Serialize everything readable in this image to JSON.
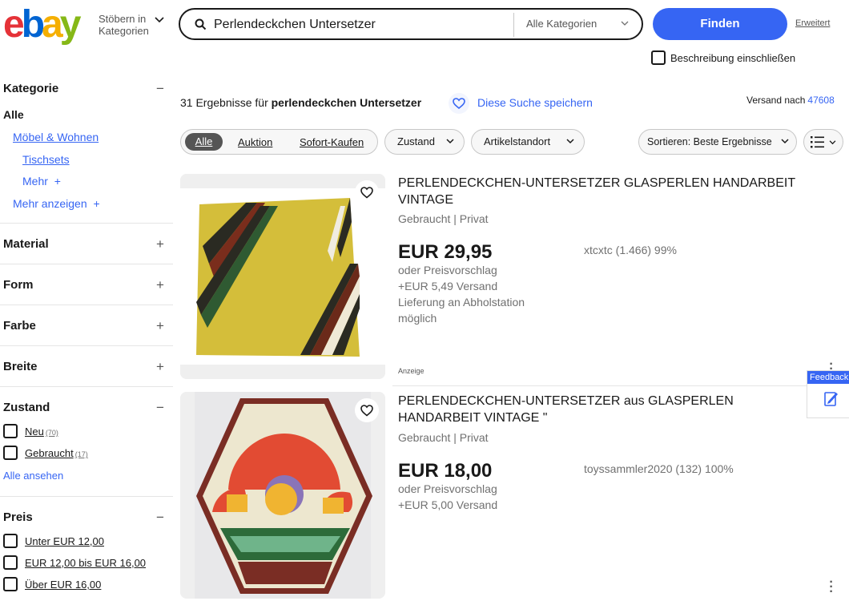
{
  "header": {
    "logo_text": "ebay",
    "browse_line1": "Stöbern in",
    "browse_line2": "Kategorien",
    "search_value": "Perlendeckchen Untersetzer",
    "category_select": "Alle Kategorien",
    "find_button": "Finden",
    "advanced_link": "Erweitert",
    "include_description": "Beschreibung einschließen"
  },
  "sidebar": {
    "category": {
      "title": "Kategorie",
      "toggle": "−",
      "all": "Alle",
      "items": [
        "Möbel & Wohnen",
        "Tischsets"
      ],
      "more": "Mehr",
      "show_more": "Mehr anzeigen"
    },
    "sections": [
      {
        "title": "Material",
        "toggle": "+"
      },
      {
        "title": "Form",
        "toggle": "+"
      },
      {
        "title": "Farbe",
        "toggle": "+"
      },
      {
        "title": "Breite",
        "toggle": "+"
      }
    ],
    "condition": {
      "title": "Zustand",
      "toggle": "−",
      "options": [
        {
          "label": "Neu",
          "count": "(70)"
        },
        {
          "label": "Gebraucht",
          "count": "(17)"
        }
      ],
      "see_all": "Alle ansehen"
    },
    "price": {
      "title": "Preis",
      "toggle": "−",
      "options": [
        "Unter EUR 12,00",
        "EUR 12,00 bis EUR 16,00",
        "Über EUR 16,00"
      ]
    }
  },
  "results": {
    "count_text": "31 Ergebnisse für",
    "query": "perlendeckchen Untersetzer",
    "save_search": "Diese Suche speichern",
    "ship_to_label": "Versand nach",
    "ship_to_zip": "47608"
  },
  "filters": {
    "format_tabs": [
      "Alle",
      "Auktion",
      "Sofort-Kaufen"
    ],
    "condition": "Zustand",
    "location": "Artikelstandort",
    "sort": "Sortieren: Beste Ergebnisse"
  },
  "items": [
    {
      "title": "PERLENDECKCHEN-UNTERSETZER GLASPERLEN HANDARBEIT VINTAGE",
      "condition": "Gebraucht | Privat",
      "price": "EUR 29,95",
      "offer": "oder Preisvorschlag",
      "shipping": "+EUR 5,49 Versand",
      "delivery": "Lieferung an Abholstation möglich",
      "seller": "xtcxtc (1.466) 99%",
      "ad": "Anzeige"
    },
    {
      "title": "PERLENDECKCHEN-UNTERSETZER aus GLASPERLEN HANDARBEIT VINTAGE \"",
      "condition": "Gebraucht | Privat",
      "price": "EUR 18,00",
      "offer": "oder Preisvorschlag",
      "shipping": "+EUR 5,00 Versand",
      "seller": "toyssammler2020 (132) 100%"
    }
  ],
  "feedback": "Feedback",
  "colors": {
    "ebay_red": "#e53238",
    "ebay_blue": "#0064d2",
    "ebay_yellow": "#f5af02",
    "ebay_green": "#86b817",
    "accent_blue": "#3665f3"
  }
}
